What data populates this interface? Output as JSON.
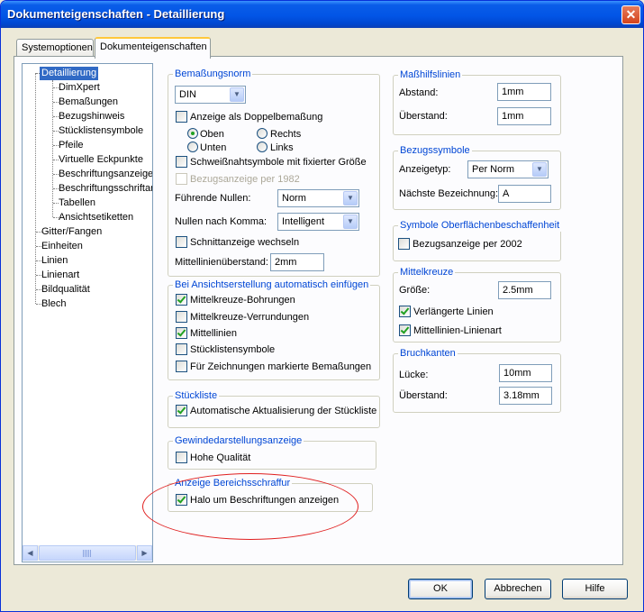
{
  "window": {
    "title": "Dokumenteigenschaften - Detaillierung",
    "close_glyph": "✕"
  },
  "tabs": [
    {
      "label": "Systemoptionen",
      "active": false
    },
    {
      "label": "Dokumenteigenschaften",
      "active": true
    }
  ],
  "tree": {
    "items": [
      "Detaillierung",
      "DimXpert",
      "Bemaßungen",
      "Bezugshinweis",
      "Stücklistensymbole",
      "Pfeile",
      "Virtuelle Eckpunkte",
      "Beschriftungsanzeige",
      "Beschriftungsschriftarten",
      "Tabellen",
      "Ansichtsetiketten",
      "Gitter/Fangen",
      "Einheiten",
      "Linien",
      "Linienart",
      "Bildqualität",
      "Blech"
    ],
    "selected": "Detaillierung",
    "scroll_left": "◀",
    "scroll_right": "▶"
  },
  "bemassungsnorm": {
    "legend": "Bemaßungsnorm",
    "standard": "DIN",
    "doppelbemassung": {
      "label": "Anzeige als Doppelbemaßung",
      "checked": false
    },
    "radios": {
      "oben": "Oben",
      "rechts": "Rechts",
      "unten": "Unten",
      "links": "Links"
    },
    "schweiss": {
      "label": "Schweißnahtsymbole mit fixierter Größe",
      "checked": false
    },
    "bezug1982": {
      "label": "Bezugsanzeige per 1982",
      "checked": false
    },
    "fuehrende_nullen": {
      "label": "Führende Nullen:",
      "value": "Norm"
    },
    "nullen_komma": {
      "label": "Nullen nach Komma:",
      "value": "Intelligent"
    },
    "schnittanzeige": {
      "label": "Schnittanzeige wechseln",
      "checked": false
    },
    "mittellinie": {
      "label": "Mittellinienüberstand:",
      "value": "2mm"
    }
  },
  "ansichtserstellung": {
    "legend": "Bei Ansichtserstellung automatisch einfügen",
    "items": [
      {
        "label": "Mittelkreuze-Bohrungen",
        "checked": true
      },
      {
        "label": "Mittelkreuze-Verrundungen",
        "checked": false
      },
      {
        "label": "Mittellinien",
        "checked": true
      },
      {
        "label": "Stücklistensymbole",
        "checked": false
      },
      {
        "label": "Für Zeichnungen markierte Bemaßungen",
        "checked": false
      }
    ]
  },
  "stueckliste": {
    "legend": "Stückliste",
    "label": "Automatische Aktualisierung der Stückliste",
    "checked": true
  },
  "gewinde": {
    "legend": "Gewindedarstellungsanzeige",
    "label": "Hohe Qualität",
    "checked": false
  },
  "bereichsschraffur": {
    "legend": "Anzeige Bereichsschraffur",
    "label": "Halo um Beschriftungen anzeigen",
    "checked": true
  },
  "masshilfslinien": {
    "legend": "Maßhilfslinien",
    "abstand": {
      "label": "Abstand:",
      "value": "1mm"
    },
    "ueberstand": {
      "label": "Überstand:",
      "value": "1mm"
    }
  },
  "bezugssymbole": {
    "legend": "Bezugssymbole",
    "anzeigetyp": {
      "label": "Anzeigetyp:",
      "value": "Per Norm"
    },
    "naechste": {
      "label": "Nächste Bezeichnung:",
      "value": "A"
    }
  },
  "oberflaeche": {
    "legend": "Symbole Oberflächenbeschaffenheit",
    "label": "Bezugsanzeige per 2002",
    "checked": false
  },
  "mittelkreuze": {
    "legend": "Mittelkreuze",
    "groesse": {
      "label": "Größe:",
      "value": "2.5mm"
    },
    "verlaengerte": {
      "label": "Verlängerte Linien",
      "checked": true
    },
    "linienart": {
      "label": "Mittellinien-Linienart",
      "checked": true
    }
  },
  "bruchkanten": {
    "legend": "Bruchkanten",
    "luecke": {
      "label": "Lücke:",
      "value": "10mm"
    },
    "ueberstand": {
      "label": "Überstand:",
      "value": "3.18mm"
    }
  },
  "buttons": {
    "ok": "OK",
    "cancel": "Abbrechen",
    "help": "Hilfe"
  },
  "dropdown_arrow": "▼"
}
